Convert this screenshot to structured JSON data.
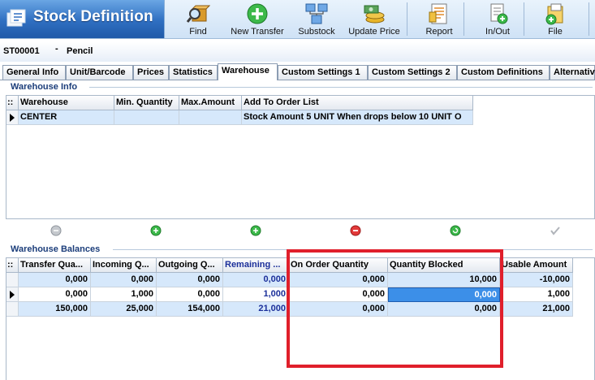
{
  "header": {
    "title": "Stock Definition",
    "title_icon": "stock-definition-icon",
    "toolbar": [
      {
        "label": "Find",
        "icon": "find-icon"
      },
      {
        "label": "New Transfer",
        "icon": "new-transfer-icon"
      },
      {
        "label": "Substock",
        "icon": "substock-icon"
      },
      {
        "label": "Update Price",
        "icon": "update-price-icon"
      },
      {
        "label": "Report",
        "icon": "report-icon"
      },
      {
        "label": "In/Out",
        "icon": "in-out-icon"
      },
      {
        "label": "File",
        "icon": "file-icon"
      }
    ]
  },
  "record": {
    "code": "ST00001",
    "separator": "-",
    "name": "Pencil"
  },
  "tabs": [
    "General Info",
    "Unit/Barcode",
    "Prices",
    "Statistics",
    "Warehouse",
    "Custom Settings 1",
    "Custom Settings 2",
    "Custom Definitions",
    "Alternative"
  ],
  "active_tab": "Warehouse",
  "warehouse_info": {
    "title": "Warehouse Info",
    "header_corner": "::",
    "columns": [
      "Warehouse",
      "Min. Quantity",
      "Max.Amount",
      "Add To Order List"
    ],
    "rows": [
      {
        "warehouse": "CENTER",
        "min_quantity": "",
        "max_amount": "",
        "add_to_order_list": "Stock Amount 5 UNIT When drops below 10 UNIT O"
      }
    ]
  },
  "nav_buttons": [
    "first-icon",
    "add-icon",
    "add-child-icon",
    "delete-icon",
    "refresh-icon",
    "confirm-icon"
  ],
  "warehouse_balances": {
    "title": "Warehouse Balances",
    "header_corner": "::",
    "columns": [
      "Transfer Qua...",
      "Incoming Q...",
      "Outgoing Q...",
      "Remaining ...",
      "On Order Quantity",
      "Quantity Blocked",
      "Usable Amount"
    ],
    "rows": [
      [
        "0,000",
        "0,000",
        "0,000",
        "0,000",
        "0,000",
        "10,000",
        "-10,000"
      ],
      [
        "0,000",
        "1,000",
        "0,000",
        "1,000",
        "0,000",
        "0,000",
        "1,000"
      ],
      [
        "150,000",
        "25,000",
        "154,000",
        "21,000",
        "0,000",
        "0,000",
        "21,000"
      ]
    ]
  },
  "colors": {
    "accent": "#2f6fc1",
    "highlight": "#e01f2b",
    "selected_row": "#d6e8fb",
    "selected_cell": "#3c8fe8",
    "remaining_header": "#1b2f9a"
  }
}
